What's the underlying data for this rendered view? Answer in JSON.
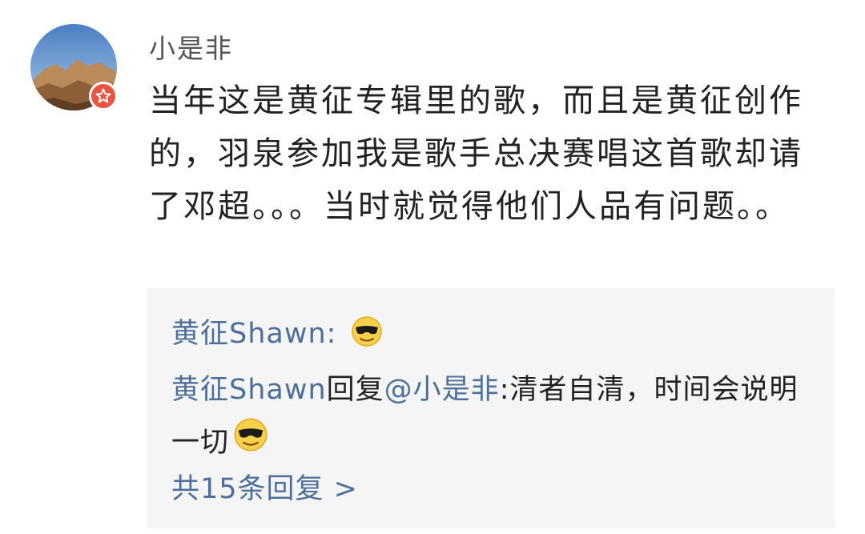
{
  "comment": {
    "username": "小是非",
    "avatar": "mountain-landscape-avatar",
    "badge_icon": "star-badge-icon",
    "body": "当年这是黄征专辑里的歌，而且是黄征创作的，羽泉参加我是歌手总决赛唱这首歌却请了邓超。。。当时就觉得他们人品有问题。。"
  },
  "replies": [
    {
      "author": "黄征Shawn",
      "separator": ":",
      "emoji": "sunglasses-emoji"
    },
    {
      "author": "黄征Shawn",
      "action": "回复",
      "mention": "@小是非",
      "colon": ":",
      "text": "清者自清，时间会说明一切",
      "emoji": "sunglasses-emoji"
    }
  ],
  "more_replies_label": "共15条回复 >",
  "colors": {
    "link": "#4e6f99",
    "text": "#222222",
    "username": "#555555",
    "reply_bg": "#f5f5f5",
    "badge": "#e9543e"
  }
}
